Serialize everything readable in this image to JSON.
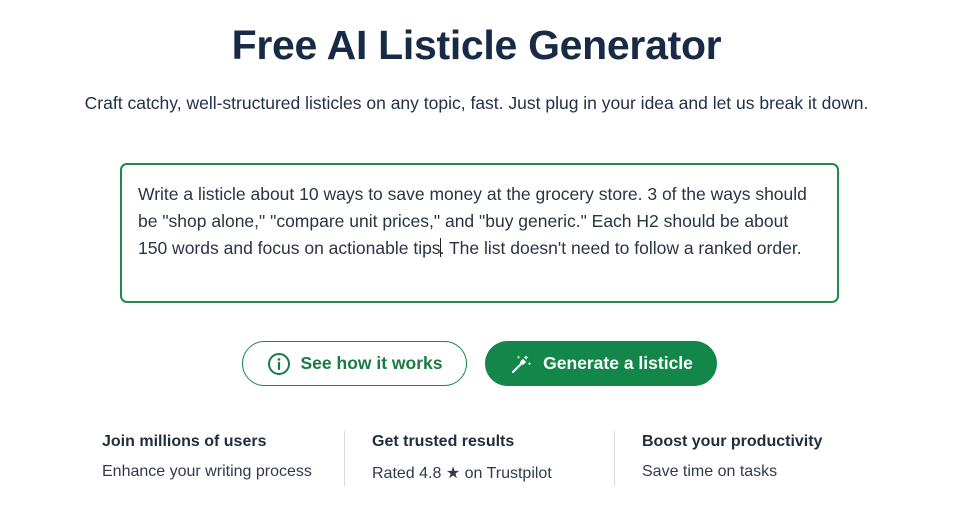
{
  "header": {
    "title": "Free AI Listicle Generator",
    "subtitle": "Craft catchy, well-structured listicles on any topic, fast. Just plug in your idea and let us break it down."
  },
  "prompt": {
    "text_before_caret": "Write a listicle about 10 ways to save money at the grocery store. 3 of the ways should be \"shop alone,\" \"compare unit prices,\" and \"buy generic.\" Each H2 should be about 150 words and focus on actionable tips",
    "text_after_caret": ". The list doesn't need to follow a ranked order."
  },
  "actions": {
    "see_how_label": "See how it works",
    "see_how_icon": "info-circle-icon",
    "generate_label": "Generate a listicle",
    "generate_icon": "magic-wand-icon"
  },
  "features": [
    {
      "title": "Join millions of users",
      "description": "Enhance your writing process"
    },
    {
      "title": "Get trusted results",
      "description": "Rated 4.8 ★ on Trustpilot"
    },
    {
      "title": "Boost your productivity",
      "description": "Save time on tasks"
    }
  ],
  "colors": {
    "accent": "#13874a",
    "title": "#172a46",
    "border": "#1f8a4c"
  }
}
